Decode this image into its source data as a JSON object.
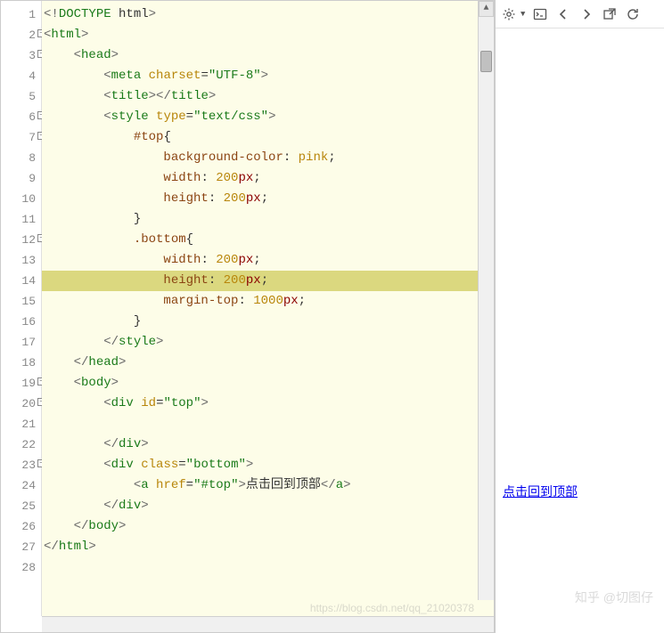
{
  "editor": {
    "highlighted_line": 14,
    "lines": [
      {
        "n": 1,
        "fold": false,
        "tokens": [
          {
            "c": "tag-bracket",
            "t": "<!"
          },
          {
            "c": "tag-name",
            "t": "DOCTYPE"
          },
          {
            "c": "text-content",
            "t": " html"
          },
          {
            "c": "tag-bracket",
            "t": ">"
          }
        ]
      },
      {
        "n": 2,
        "fold": true,
        "tokens": [
          {
            "c": "tag-bracket",
            "t": "<"
          },
          {
            "c": "tag-name",
            "t": "html"
          },
          {
            "c": "tag-bracket",
            "t": ">"
          }
        ]
      },
      {
        "n": 3,
        "fold": true,
        "indent": 4,
        "tokens": [
          {
            "c": "tag-bracket",
            "t": "<"
          },
          {
            "c": "tag-name",
            "t": "head"
          },
          {
            "c": "tag-bracket",
            "t": ">"
          }
        ]
      },
      {
        "n": 4,
        "indent": 8,
        "tokens": [
          {
            "c": "tag-bracket",
            "t": "<"
          },
          {
            "c": "tag-name",
            "t": "meta"
          },
          {
            "c": "text-content",
            "t": " "
          },
          {
            "c": "attr-name",
            "t": "charset"
          },
          {
            "c": "punct",
            "t": "="
          },
          {
            "c": "attr-val",
            "t": "\"UTF-8\""
          },
          {
            "c": "tag-bracket",
            "t": ">"
          }
        ]
      },
      {
        "n": 5,
        "indent": 8,
        "tokens": [
          {
            "c": "tag-bracket",
            "t": "<"
          },
          {
            "c": "tag-name",
            "t": "title"
          },
          {
            "c": "tag-bracket",
            "t": "></"
          },
          {
            "c": "tag-name",
            "t": "title"
          },
          {
            "c": "tag-bracket",
            "t": ">"
          }
        ]
      },
      {
        "n": 6,
        "fold": true,
        "indent": 8,
        "tokens": [
          {
            "c": "tag-bracket",
            "t": "<"
          },
          {
            "c": "tag-name",
            "t": "style"
          },
          {
            "c": "text-content",
            "t": " "
          },
          {
            "c": "attr-name",
            "t": "type"
          },
          {
            "c": "punct",
            "t": "="
          },
          {
            "c": "attr-val",
            "t": "\"text/css\""
          },
          {
            "c": "tag-bracket",
            "t": ">"
          }
        ]
      },
      {
        "n": 7,
        "fold": true,
        "indent": 12,
        "tokens": [
          {
            "c": "css-sel",
            "t": "#top"
          },
          {
            "c": "punct",
            "t": "{"
          }
        ]
      },
      {
        "n": 8,
        "indent": 16,
        "tokens": [
          {
            "c": "css-prop",
            "t": "background-color"
          },
          {
            "c": "punct",
            "t": ": "
          },
          {
            "c": "css-val-kw",
            "t": "pink"
          },
          {
            "c": "punct",
            "t": ";"
          }
        ]
      },
      {
        "n": 9,
        "indent": 16,
        "tokens": [
          {
            "c": "css-prop",
            "t": "width"
          },
          {
            "c": "punct",
            "t": ": "
          },
          {
            "c": "css-val-num",
            "t": "200"
          },
          {
            "c": "css-val-unit",
            "t": "px"
          },
          {
            "c": "punct",
            "t": ";"
          }
        ]
      },
      {
        "n": 10,
        "indent": 16,
        "tokens": [
          {
            "c": "css-prop",
            "t": "height"
          },
          {
            "c": "punct",
            "t": ": "
          },
          {
            "c": "css-val-num",
            "t": "200"
          },
          {
            "c": "css-val-unit",
            "t": "px"
          },
          {
            "c": "punct",
            "t": ";"
          }
        ]
      },
      {
        "n": 11,
        "indent": 12,
        "tokens": [
          {
            "c": "punct",
            "t": "}"
          }
        ]
      },
      {
        "n": 12,
        "fold": true,
        "indent": 12,
        "tokens": [
          {
            "c": "css-sel",
            "t": ".bottom"
          },
          {
            "c": "punct",
            "t": "{"
          }
        ]
      },
      {
        "n": 13,
        "indent": 16,
        "tokens": [
          {
            "c": "css-prop",
            "t": "width"
          },
          {
            "c": "punct",
            "t": ": "
          },
          {
            "c": "css-val-num",
            "t": "200"
          },
          {
            "c": "css-val-unit",
            "t": "px"
          },
          {
            "c": "punct",
            "t": ";"
          }
        ]
      },
      {
        "n": 14,
        "indent": 16,
        "tokens": [
          {
            "c": "css-prop",
            "t": "height"
          },
          {
            "c": "punct",
            "t": ": "
          },
          {
            "c": "css-val-num",
            "t": "200"
          },
          {
            "c": "css-val-unit",
            "t": "px"
          },
          {
            "c": "punct",
            "t": ";"
          }
        ]
      },
      {
        "n": 15,
        "indent": 16,
        "tokens": [
          {
            "c": "css-prop",
            "t": "margin-top"
          },
          {
            "c": "punct",
            "t": ": "
          },
          {
            "c": "css-val-num",
            "t": "1000"
          },
          {
            "c": "css-val-unit",
            "t": "px"
          },
          {
            "c": "punct",
            "t": ";"
          }
        ]
      },
      {
        "n": 16,
        "indent": 12,
        "tokens": [
          {
            "c": "punct",
            "t": "}"
          }
        ]
      },
      {
        "n": 17,
        "indent": 8,
        "tokens": [
          {
            "c": "tag-bracket",
            "t": "</"
          },
          {
            "c": "tag-name",
            "t": "style"
          },
          {
            "c": "tag-bracket",
            "t": ">"
          }
        ]
      },
      {
        "n": 18,
        "indent": 4,
        "tokens": [
          {
            "c": "tag-bracket",
            "t": "</"
          },
          {
            "c": "tag-name",
            "t": "head"
          },
          {
            "c": "tag-bracket",
            "t": ">"
          }
        ]
      },
      {
        "n": 19,
        "fold": true,
        "indent": 4,
        "tokens": [
          {
            "c": "tag-bracket",
            "t": "<"
          },
          {
            "c": "tag-name",
            "t": "body"
          },
          {
            "c": "tag-bracket",
            "t": ">"
          }
        ]
      },
      {
        "n": 20,
        "fold": true,
        "indent": 8,
        "tokens": [
          {
            "c": "tag-bracket",
            "t": "<"
          },
          {
            "c": "tag-name",
            "t": "div"
          },
          {
            "c": "text-content",
            "t": " "
          },
          {
            "c": "attr-name",
            "t": "id"
          },
          {
            "c": "punct",
            "t": "="
          },
          {
            "c": "attr-val",
            "t": "\"top\""
          },
          {
            "c": "tag-bracket",
            "t": ">"
          }
        ]
      },
      {
        "n": 21,
        "indent": 12,
        "tokens": []
      },
      {
        "n": 22,
        "indent": 8,
        "tokens": [
          {
            "c": "tag-bracket",
            "t": "</"
          },
          {
            "c": "tag-name",
            "t": "div"
          },
          {
            "c": "tag-bracket",
            "t": ">"
          }
        ]
      },
      {
        "n": 23,
        "fold": true,
        "indent": 8,
        "tokens": [
          {
            "c": "tag-bracket",
            "t": "<"
          },
          {
            "c": "tag-name",
            "t": "div"
          },
          {
            "c": "text-content",
            "t": " "
          },
          {
            "c": "attr-name",
            "t": "class"
          },
          {
            "c": "punct",
            "t": "="
          },
          {
            "c": "attr-val",
            "t": "\"bottom\""
          },
          {
            "c": "tag-bracket",
            "t": ">"
          }
        ]
      },
      {
        "n": 24,
        "indent": 12,
        "tokens": [
          {
            "c": "tag-bracket",
            "t": "<"
          },
          {
            "c": "tag-name",
            "t": "a"
          },
          {
            "c": "text-content",
            "t": " "
          },
          {
            "c": "attr-name",
            "t": "href"
          },
          {
            "c": "punct",
            "t": "="
          },
          {
            "c": "attr-val",
            "t": "\"#top\""
          },
          {
            "c": "tag-bracket",
            "t": ">"
          },
          {
            "c": "text-content",
            "t": "点击回到顶部"
          },
          {
            "c": "tag-bracket",
            "t": "</"
          },
          {
            "c": "tag-name",
            "t": "a"
          },
          {
            "c": "tag-bracket",
            "t": ">"
          }
        ]
      },
      {
        "n": 25,
        "indent": 8,
        "tokens": [
          {
            "c": "tag-bracket",
            "t": "</"
          },
          {
            "c": "tag-name",
            "t": "div"
          },
          {
            "c": "tag-bracket",
            "t": ">"
          }
        ]
      },
      {
        "n": 26,
        "indent": 4,
        "tokens": [
          {
            "c": "tag-bracket",
            "t": "</"
          },
          {
            "c": "tag-name",
            "t": "body"
          },
          {
            "c": "tag-bracket",
            "t": ">"
          }
        ]
      },
      {
        "n": 27,
        "tokens": [
          {
            "c": "tag-bracket",
            "t": "</"
          },
          {
            "c": "tag-name",
            "t": "html"
          },
          {
            "c": "tag-bracket",
            "t": ">"
          }
        ]
      },
      {
        "n": 28,
        "tokens": []
      }
    ]
  },
  "preview": {
    "link_text": "点击回到顶部"
  },
  "watermarks": {
    "url": "https://blog.csdn.net/qq_21020378",
    "zhihu": "知乎 @切图仔"
  },
  "toolbar_icons": [
    "settings-icon",
    "console-icon",
    "back-icon",
    "forward-icon",
    "external-icon",
    "refresh-icon"
  ]
}
